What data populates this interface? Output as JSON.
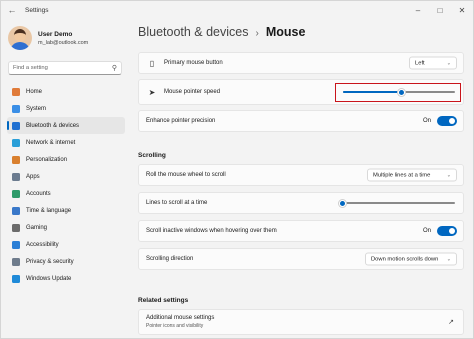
{
  "window": {
    "app_title": "Settings",
    "back_icon": "back-arrow-icon",
    "controls": [
      "minimize-icon",
      "maximize-icon",
      "close-icon"
    ]
  },
  "user": {
    "name": "User Demo",
    "email": "m_lab@outlook.com"
  },
  "search": {
    "placeholder": "Find a setting"
  },
  "sidebar": {
    "items": [
      {
        "label": "Home",
        "icon": "home-icon",
        "color": "#e07b39",
        "active": false
      },
      {
        "label": "System",
        "icon": "system-icon",
        "color": "#3a8ee6",
        "active": false
      },
      {
        "label": "Bluetooth & devices",
        "icon": "bluetooth-icon",
        "color": "#1f6fd1",
        "active": true
      },
      {
        "label": "Network & internet",
        "icon": "network-icon",
        "color": "#2a9fd8",
        "active": false
      },
      {
        "label": "Personalization",
        "icon": "personalization-icon",
        "color": "#d9802e",
        "active": false
      },
      {
        "label": "Apps",
        "icon": "apps-icon",
        "color": "#6b7b8f",
        "active": false
      },
      {
        "label": "Accounts",
        "icon": "accounts-icon",
        "color": "#2e9b6a",
        "active": false
      },
      {
        "label": "Time & language",
        "icon": "time-language-icon",
        "color": "#3a78c9",
        "active": false
      },
      {
        "label": "Gaming",
        "icon": "gaming-icon",
        "color": "#6b6b6b",
        "active": false
      },
      {
        "label": "Accessibility",
        "icon": "accessibility-icon",
        "color": "#2b7fd6",
        "active": false
      },
      {
        "label": "Privacy & security",
        "icon": "shield-icon",
        "color": "#6f7c8c",
        "active": false
      },
      {
        "label": "Windows Update",
        "icon": "windows-update-icon",
        "color": "#1f8ad8",
        "active": false
      }
    ]
  },
  "breadcrumb": {
    "parent": "Bluetooth & devices",
    "separator": "›",
    "current": "Mouse"
  },
  "settings": {
    "primary_button": {
      "label": "Primary mouse button",
      "value": "Left",
      "icon": "mouse-icon"
    },
    "pointer_speed": {
      "label": "Mouse pointer speed",
      "icon": "pointer-icon",
      "level": 0.52
    },
    "precision": {
      "label": "Enhance pointer precision",
      "state": "On"
    }
  },
  "scrolling": {
    "title": "Scrolling",
    "wheel": {
      "label": "Roll the mouse wheel to scroll",
      "value": "Multiple lines at a time"
    },
    "lines": {
      "label": "Lines to scroll at a time",
      "level": 0.03
    },
    "inactive": {
      "label": "Scroll inactive windows when hovering over them",
      "state": "On"
    },
    "direction": {
      "label": "Scrolling direction",
      "value": "Down motion scrolls down"
    }
  },
  "related": {
    "title": "Related settings",
    "additional": {
      "label": "Additional mouse settings",
      "sublabel": "Pointer icons and visibility",
      "icon": "external-link-icon"
    }
  },
  "colors": {
    "accent": "#0067c0",
    "highlight": "#c9141b"
  }
}
